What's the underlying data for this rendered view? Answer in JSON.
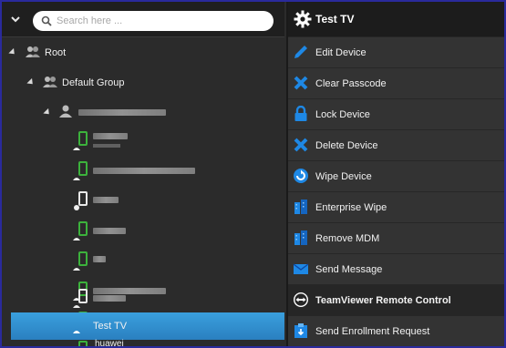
{
  "search": {
    "placeholder": "Search here ..."
  },
  "tree": {
    "root_label": "Root",
    "group_label": "Default Group",
    "selected_label": "Test TV",
    "last_label": "huawei"
  },
  "panel": {
    "title": "Test TV",
    "items": [
      {
        "label": "Edit Device",
        "icon": "pencil-icon"
      },
      {
        "label": "Clear Passcode",
        "icon": "x-mark-icon"
      },
      {
        "label": "Lock Device",
        "icon": "lock-icon"
      },
      {
        "label": "Delete Device",
        "icon": "x-mark-icon"
      },
      {
        "label": "Wipe Device",
        "icon": "wipe-icon"
      },
      {
        "label": "Enterprise Wipe",
        "icon": "enterprise-wipe-icon"
      },
      {
        "label": "Remove MDM",
        "icon": "remove-mdm-icon"
      },
      {
        "label": "Send Message",
        "icon": "envelope-icon"
      },
      {
        "label": "TeamViewer Remote Control",
        "icon": "teamviewer-icon"
      },
      {
        "label": "Send Enrollment Request",
        "icon": "enrollment-icon"
      }
    ]
  },
  "colors": {
    "accent": "#2e8fd4",
    "icon_blue": "#1e88e5",
    "android_green": "#3cb23c"
  }
}
